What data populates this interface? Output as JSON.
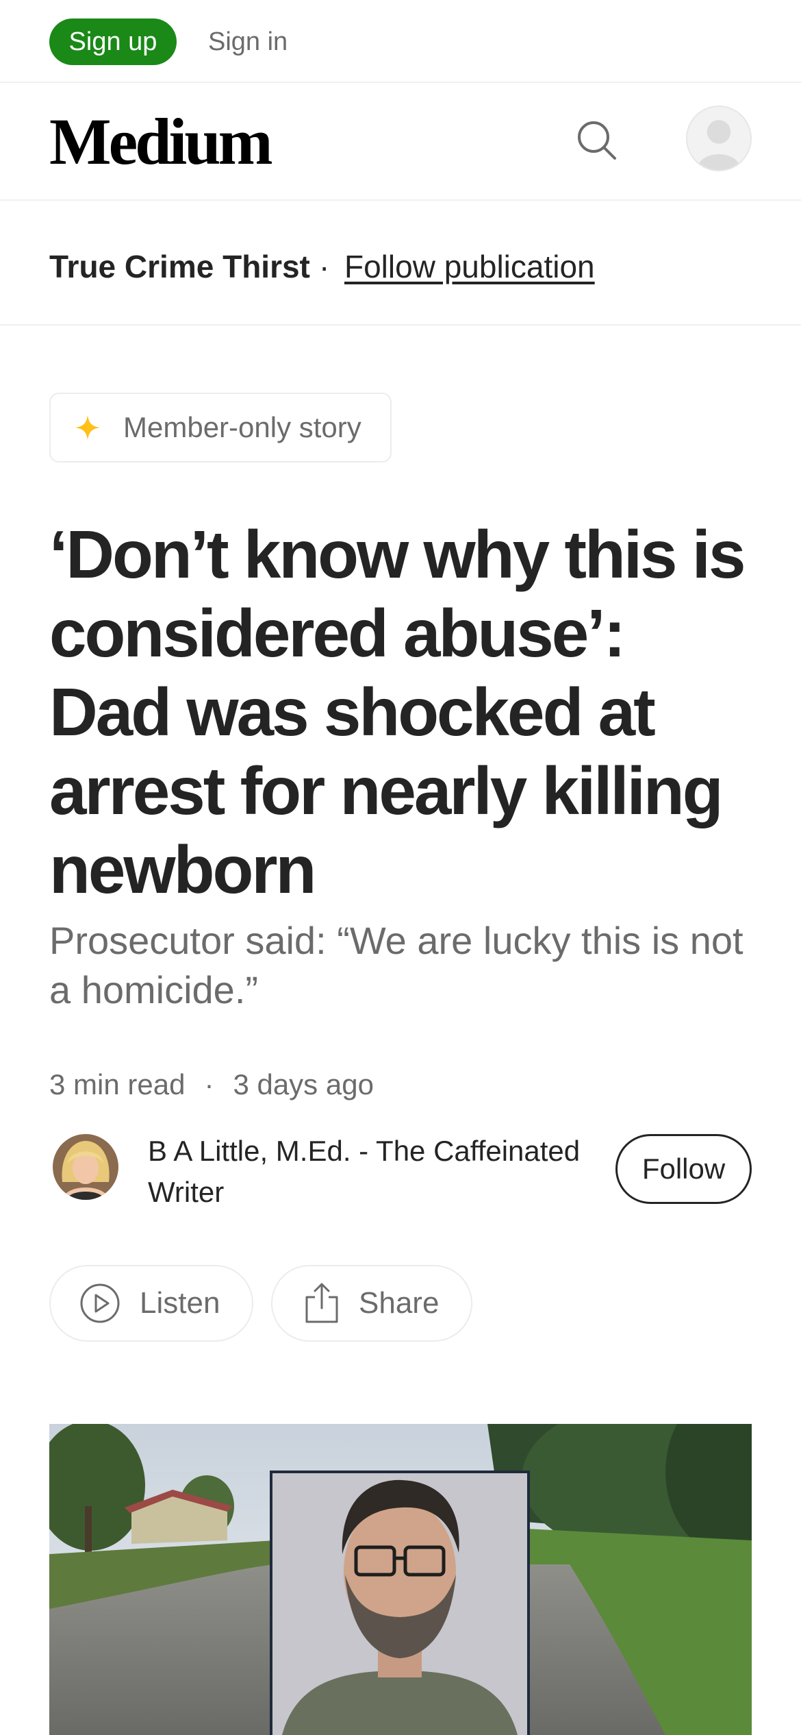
{
  "auth": {
    "signup_label": "Sign up",
    "signin_label": "Sign in"
  },
  "header": {
    "logo": "Medium",
    "search_icon": "search-icon",
    "avatar_icon": "user-avatar-icon"
  },
  "publication": {
    "name": "True Crime Thirst",
    "separator": "·",
    "follow_label": "Follow publication"
  },
  "badge": {
    "label": "Member-only story",
    "icon": "sparkle-star-icon",
    "icon_color": "#ffc017"
  },
  "article": {
    "title": "‘Don’t know why this is considered abuse’: Dad was shocked at arrest for nearly killing newborn",
    "subtitle": "Prosecutor said: “We are lucky this is not a homicide.”",
    "read_time": "3 min read",
    "separator": "·",
    "published": "3 days ago"
  },
  "author": {
    "name": "B A Little, M.Ed. - The Caffeinated Writer",
    "follow_label": "Follow"
  },
  "actions": {
    "listen_label": "Listen",
    "share_label": "Share"
  },
  "colors": {
    "accent": "#1a8917",
    "text": "#242424",
    "muted": "#6b6b6b"
  }
}
